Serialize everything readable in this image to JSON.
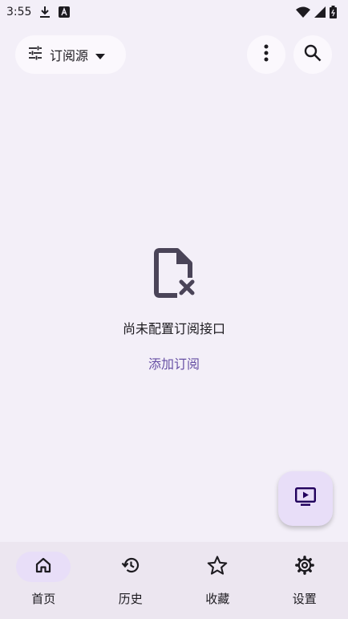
{
  "status_bar": {
    "time": "3:55"
  },
  "top_bar": {
    "source_label": "订阅源"
  },
  "empty_state": {
    "message": "尚未配置订阅接口",
    "action_label": "添加订阅"
  },
  "bottom_nav": {
    "items": [
      {
        "label": "首页",
        "icon": "home-icon",
        "active": true
      },
      {
        "label": "历史",
        "icon": "history-icon",
        "active": false
      },
      {
        "label": "收藏",
        "icon": "star-icon",
        "active": false
      },
      {
        "label": "设置",
        "icon": "gear-icon",
        "active": false
      }
    ]
  },
  "colors": {
    "background": "#f3eff8",
    "accent": "#6750a4",
    "container": "#e8def8",
    "nav_bar": "#ece6f0"
  }
}
